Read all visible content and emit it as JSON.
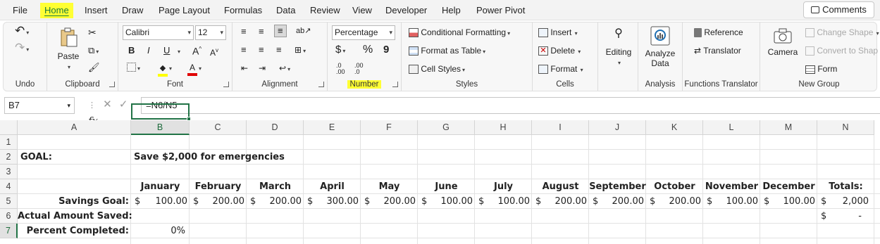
{
  "menu": {
    "tabs": [
      "File",
      "Home",
      "Insert",
      "Draw",
      "Page Layout",
      "Formulas",
      "Data",
      "Review",
      "View",
      "Developer",
      "Help",
      "Power Pivot"
    ],
    "active_tab": "Home",
    "comments_label": "Comments"
  },
  "ribbon": {
    "undo_group": "Undo",
    "clipboard": {
      "label": "Clipboard",
      "paste": "Paste"
    },
    "font": {
      "label": "Font",
      "name": "Calibri",
      "size": "12",
      "bold": "B",
      "italic": "I",
      "underline": "U",
      "grow": "A",
      "shrink": "A"
    },
    "alignment": {
      "label": "Alignment"
    },
    "number": {
      "label": "Number",
      "format": "Percentage",
      "currency": "$",
      "percent": "%",
      "comma": "9",
      "inc_dec_a": ".0",
      "inc_dec_b": ".00"
    },
    "styles": {
      "label": "Styles",
      "conditional": "Conditional Formatting",
      "format_table": "Format as Table",
      "cell_styles": "Cell Styles"
    },
    "cells": {
      "label": "Cells",
      "insert": "Insert",
      "delete": "Delete",
      "format": "Format"
    },
    "editing": {
      "label": "Editing"
    },
    "analysis": {
      "label": "Analysis",
      "analyze": "Analyze",
      "data": "Data"
    },
    "functions_translator": {
      "label": "Functions Translator",
      "reference": "Reference",
      "translator": "Translator"
    },
    "new_group": {
      "label": "New Group",
      "camera": "Camera",
      "change_shape": "Change Shape",
      "convert": "Convert to Shape",
      "form": "Form"
    }
  },
  "formula_bar": {
    "name_box": "B7",
    "formula": "=N6/N5"
  },
  "sheet": {
    "columns": [
      "A",
      "B",
      "C",
      "D",
      "E",
      "F",
      "G",
      "H",
      "I",
      "J",
      "K",
      "L",
      "M",
      "N"
    ],
    "rows": [
      "1",
      "2",
      "3",
      "4",
      "5",
      "6",
      "7"
    ],
    "goal_label": "GOAL:",
    "goal_text": "Save $2,000 for emergencies",
    "months": [
      "January",
      "February",
      "March",
      "April",
      "May",
      "June",
      "July",
      "August",
      "September",
      "October",
      "November",
      "December"
    ],
    "totals_label": "Totals:",
    "savings_goal_label": "Savings Goal:",
    "savings_goal_values": [
      "100.00",
      "200.00",
      "200.00",
      "300.00",
      "200.00",
      "100.00",
      "100.00",
      "200.00",
      "200.00",
      "200.00",
      "100.00",
      "100.00"
    ],
    "savings_goal_total": "2,000",
    "actual_label": "Actual Amount Saved:",
    "actual_total": "-",
    "percent_label": "Percent Completed:",
    "percent_value": "0%",
    "currency_symbol": "$"
  }
}
